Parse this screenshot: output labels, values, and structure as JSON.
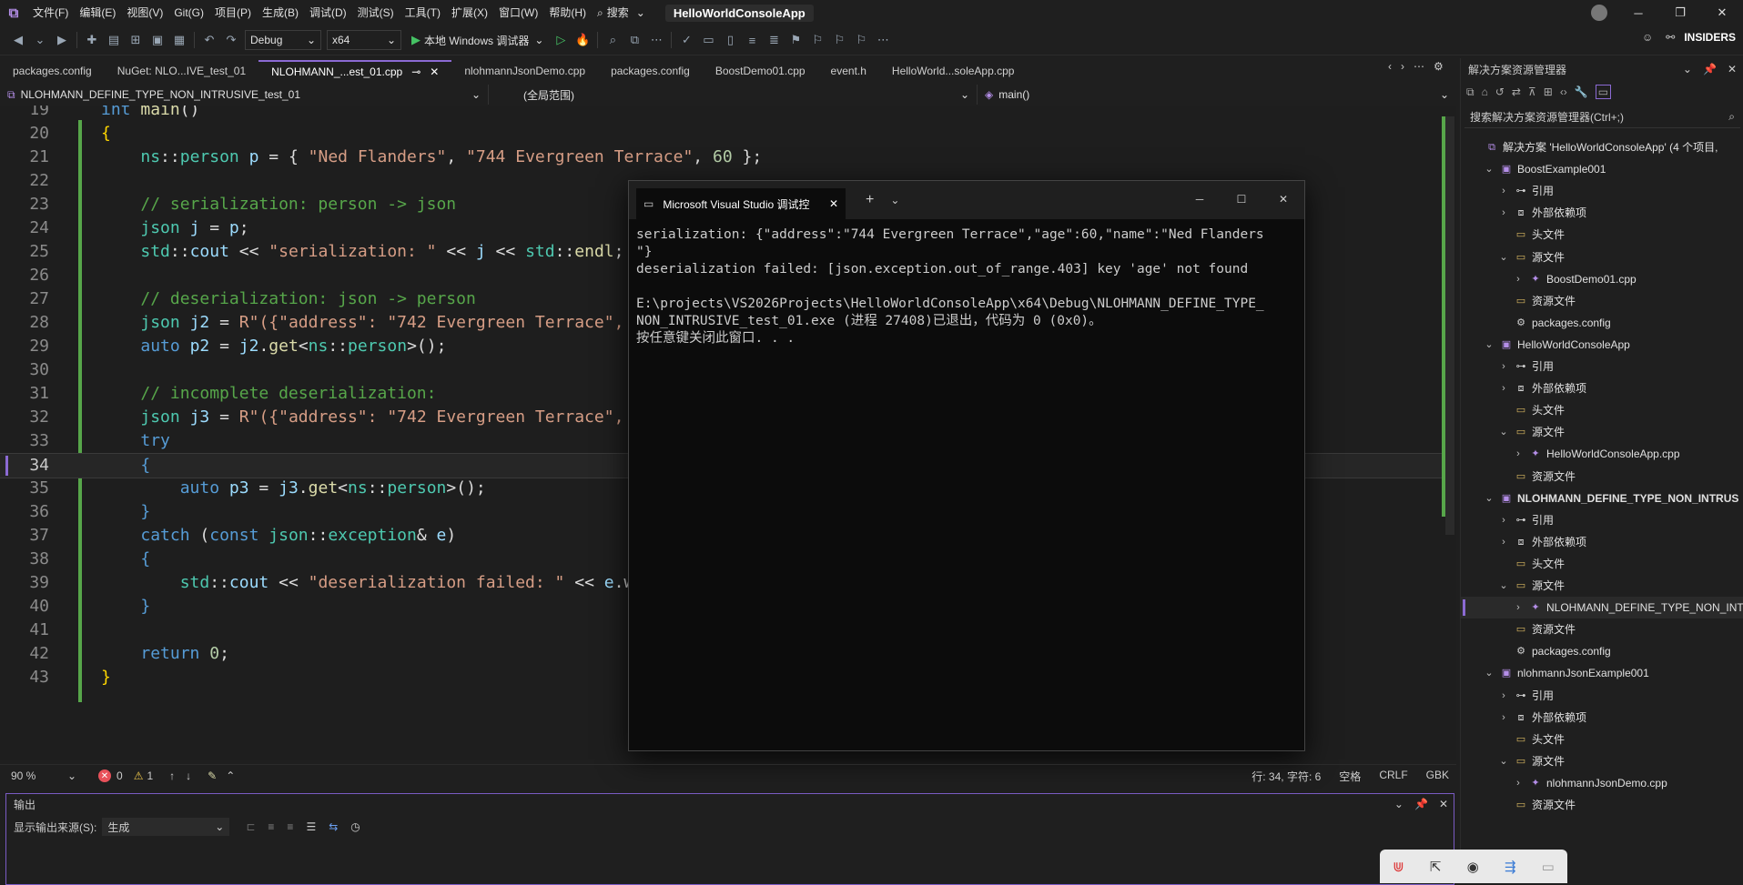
{
  "menubar": {
    "items": [
      "文件(F)",
      "编辑(E)",
      "视图(V)",
      "Git(G)",
      "项目(P)",
      "生成(B)",
      "调试(D)",
      "测试(S)",
      "工具(T)",
      "扩展(X)",
      "窗口(W)",
      "帮助(H)"
    ],
    "search_label": "搜索",
    "app_title": "HelloWorldConsoleApp"
  },
  "toolbar": {
    "config": "Debug",
    "platform": "x64",
    "run_label": "本地 Windows 调试器",
    "insiders": "INSIDERS"
  },
  "tabs": [
    {
      "label": "packages.config",
      "active": false
    },
    {
      "label": "NuGet: NLO...IVE_test_01",
      "active": false
    },
    {
      "label": "NLOHMANN_...est_01.cpp",
      "active": true
    },
    {
      "label": "nlohmannJsonDemo.cpp",
      "active": false
    },
    {
      "label": "packages.config",
      "active": false
    },
    {
      "label": "BoostDemo01.cpp",
      "active": false
    },
    {
      "label": "event.h",
      "active": false
    },
    {
      "label": "HelloWorld...soleApp.cpp",
      "active": false
    }
  ],
  "navbar": {
    "project": "NLOHMANN_DEFINE_TYPE_NON_INTRUSIVE_test_01",
    "scope": "(全局范围)",
    "member": "main()"
  },
  "editor": {
    "current_line": "34",
    "lines": [
      {
        "n": "19",
        "html": "<span class='kw'>int</span> <span class='fn'>main</span>()"
      },
      {
        "n": "20",
        "html": "<span class='br'>{</span>"
      },
      {
        "n": "21",
        "html": "    <span class='ty'>ns</span>::<span class='ty'>person</span> <span class='vr'>p</span> = { <span class='str'>\"Ned Flanders\"</span>, <span class='str'>\"744 Evergreen Terrace\"</span>, <span class='num'>60</span> };"
      },
      {
        "n": "22",
        "html": ""
      },
      {
        "n": "23",
        "html": "    <span class='cm'>// serialization: person -> json</span>"
      },
      {
        "n": "24",
        "html": "    <span class='ty'>json</span> <span class='vr'>j</span> = <span class='vr'>p</span>;"
      },
      {
        "n": "25",
        "html": "    <span class='ty'>std</span>::<span class='vr'>cout</span> << <span class='str'>\"serialization: \"</span> << <span class='vr'>j</span> << <span class='ty'>std</span>::<span class='fn'>endl</span>;"
      },
      {
        "n": "26",
        "html": ""
      },
      {
        "n": "27",
        "html": "    <span class='cm'>// deserialization: json -> person</span>"
      },
      {
        "n": "28",
        "html": "    <span class='ty'>json</span> <span class='vr'>j2</span> = <span class='str'>R\"({\"address\": \"742 Evergreen Terrace\",</span>"
      },
      {
        "n": "29",
        "html": "    <span class='kw'>auto</span> <span class='vr'>p2</span> = <span class='vr'>j2</span>.<span class='fn'>get</span><<span class='ty'>ns</span>::<span class='ty'>person</span>>();"
      },
      {
        "n": "30",
        "html": ""
      },
      {
        "n": "31",
        "html": "    <span class='cm'>// incomplete deserialization:</span>"
      },
      {
        "n": "32",
        "html": "    <span class='ty'>json</span> <span class='vr'>j3</span> = <span class='str'>R\"({\"address\": \"742 Evergreen Terrace\",</span>"
      },
      {
        "n": "33",
        "html": "    <span class='kw'>try</span>"
      },
      {
        "n": "34",
        "html": "    <span class='kw'>{</span>"
      },
      {
        "n": "35",
        "html": "        <span class='kw'>auto</span> <span class='vr'>p3</span> = <span class='vr'>j3</span>.<span class='fn'>get</span><<span class='ty'>ns</span>::<span class='ty'>person</span>>();"
      },
      {
        "n": "36",
        "html": "    <span class='kw'>}</span>"
      },
      {
        "n": "37",
        "html": "    <span class='kw'>catch</span> (<span class='kw'>const</span> <span class='ty'>json</span>::<span class='ty'>exception</span>& <span class='vr'>e</span>)"
      },
      {
        "n": "38",
        "html": "    <span class='kw'>{</span>"
      },
      {
        "n": "39",
        "html": "        <span class='ty'>std</span>::<span class='vr'>cout</span> << <span class='str'>\"deserialization failed: \"</span> << <span class='vr'>e</span>.w"
      },
      {
        "n": "40",
        "html": "    <span class='kw'>}</span>"
      },
      {
        "n": "41",
        "html": ""
      },
      {
        "n": "42",
        "html": "    <span class='kw'>return</span> <span class='num'>0</span>;"
      },
      {
        "n": "43",
        "html": "<span class='br'>}</span>"
      }
    ]
  },
  "console": {
    "title": "Microsoft Visual Studio 调试控",
    "output": "serialization: {\"address\":\"744 Evergreen Terrace\",\"age\":60,\"name\":\"Ned Flanders\n\"}\ndeserialization failed: [json.exception.out_of_range.403] key 'age' not found\n\nE:\\projects\\VS2026Projects\\HelloWorldConsoleApp\\x64\\Debug\\NLOHMANN_DEFINE_TYPE_\nNON_INTRUSIVE_test_01.exe (进程 27408)已退出，代码为 0 (0x0)。\n按任意键关闭此窗口. . ."
  },
  "status": {
    "zoom": "90 %",
    "errors": "0",
    "warnings": "1",
    "position": "行: 34, 字符: 6",
    "whitespace": "空格",
    "line_ending": "CRLF",
    "encoding": "GBK"
  },
  "output_panel": {
    "title": "输出",
    "source_label": "显示输出来源(S):",
    "source_value": "生成"
  },
  "solution_explorer": {
    "title": "解决方案资源管理器",
    "search_placeholder": "搜索解决方案资源管理器(Ctrl+;)",
    "nodes": [
      {
        "label": "解决方案 'HelloWorldConsoleApp' (4 个项目,",
        "indent": 0,
        "arrow": "",
        "icon": "solution",
        "bold": false
      },
      {
        "label": "BoostExample001",
        "indent": 1,
        "arrow": "v",
        "icon": "project",
        "bold": false
      },
      {
        "label": "引用",
        "indent": 2,
        "arrow": ">",
        "icon": "ref",
        "bold": false
      },
      {
        "label": "外部依赖项",
        "indent": 2,
        "arrow": ">",
        "icon": "ext",
        "bold": false
      },
      {
        "label": "头文件",
        "indent": 2,
        "arrow": "",
        "icon": "folder",
        "bold": false
      },
      {
        "label": "源文件",
        "indent": 2,
        "arrow": "v",
        "icon": "folder",
        "bold": false
      },
      {
        "label": "BoostDemo01.cpp",
        "indent": 3,
        "arrow": ">",
        "icon": "cpp",
        "bold": false
      },
      {
        "label": "资源文件",
        "indent": 2,
        "arrow": "",
        "icon": "folder",
        "bold": false
      },
      {
        "label": "packages.config",
        "indent": 2,
        "arrow": "",
        "icon": "config",
        "bold": false
      },
      {
        "label": "HelloWorldConsoleApp",
        "indent": 1,
        "arrow": "v",
        "icon": "project",
        "bold": false
      },
      {
        "label": "引用",
        "indent": 2,
        "arrow": ">",
        "icon": "ref",
        "bold": false
      },
      {
        "label": "外部依赖项",
        "indent": 2,
        "arrow": ">",
        "icon": "ext",
        "bold": false
      },
      {
        "label": "头文件",
        "indent": 2,
        "arrow": "",
        "icon": "folder",
        "bold": false
      },
      {
        "label": "源文件",
        "indent": 2,
        "arrow": "v",
        "icon": "folder",
        "bold": false
      },
      {
        "label": "HelloWorldConsoleApp.cpp",
        "indent": 3,
        "arrow": ">",
        "icon": "cpp",
        "bold": false
      },
      {
        "label": "资源文件",
        "indent": 2,
        "arrow": "",
        "icon": "folder",
        "bold": false
      },
      {
        "label": "NLOHMANN_DEFINE_TYPE_NON_INTRUS",
        "indent": 1,
        "arrow": "v",
        "icon": "project",
        "bold": true
      },
      {
        "label": "引用",
        "indent": 2,
        "arrow": ">",
        "icon": "ref",
        "bold": false
      },
      {
        "label": "外部依赖项",
        "indent": 2,
        "arrow": ">",
        "icon": "ext",
        "bold": false
      },
      {
        "label": "头文件",
        "indent": 2,
        "arrow": "",
        "icon": "folder",
        "bold": false
      },
      {
        "label": "源文件",
        "indent": 2,
        "arrow": "v",
        "icon": "folder",
        "bold": false
      },
      {
        "label": "NLOHMANN_DEFINE_TYPE_NON_INTR",
        "indent": 3,
        "arrow": ">",
        "icon": "cpp",
        "bold": false
      },
      {
        "label": "资源文件",
        "indent": 2,
        "arrow": "",
        "icon": "folder",
        "bold": false
      },
      {
        "label": "packages.config",
        "indent": 2,
        "arrow": "",
        "icon": "config",
        "bold": false
      },
      {
        "label": "nlohmannJsonExample001",
        "indent": 1,
        "arrow": "v",
        "icon": "project",
        "bold": false
      },
      {
        "label": "引用",
        "indent": 2,
        "arrow": ">",
        "icon": "ref",
        "bold": false
      },
      {
        "label": "外部依赖项",
        "indent": 2,
        "arrow": ">",
        "icon": "ext",
        "bold": false
      },
      {
        "label": "头文件",
        "indent": 2,
        "arrow": "",
        "icon": "folder",
        "bold": false
      },
      {
        "label": "源文件",
        "indent": 2,
        "arrow": "v",
        "icon": "folder",
        "bold": false
      },
      {
        "label": "nlohmannJsonDemo.cpp",
        "indent": 3,
        "arrow": ">",
        "icon": "cpp",
        "bold": false
      },
      {
        "label": "资源文件",
        "indent": 2,
        "arrow": "",
        "icon": "folder",
        "bold": false
      }
    ]
  },
  "colors": {
    "accent": "#8b6ad3",
    "change_bar": "#57a64a",
    "run": "#45c264"
  }
}
